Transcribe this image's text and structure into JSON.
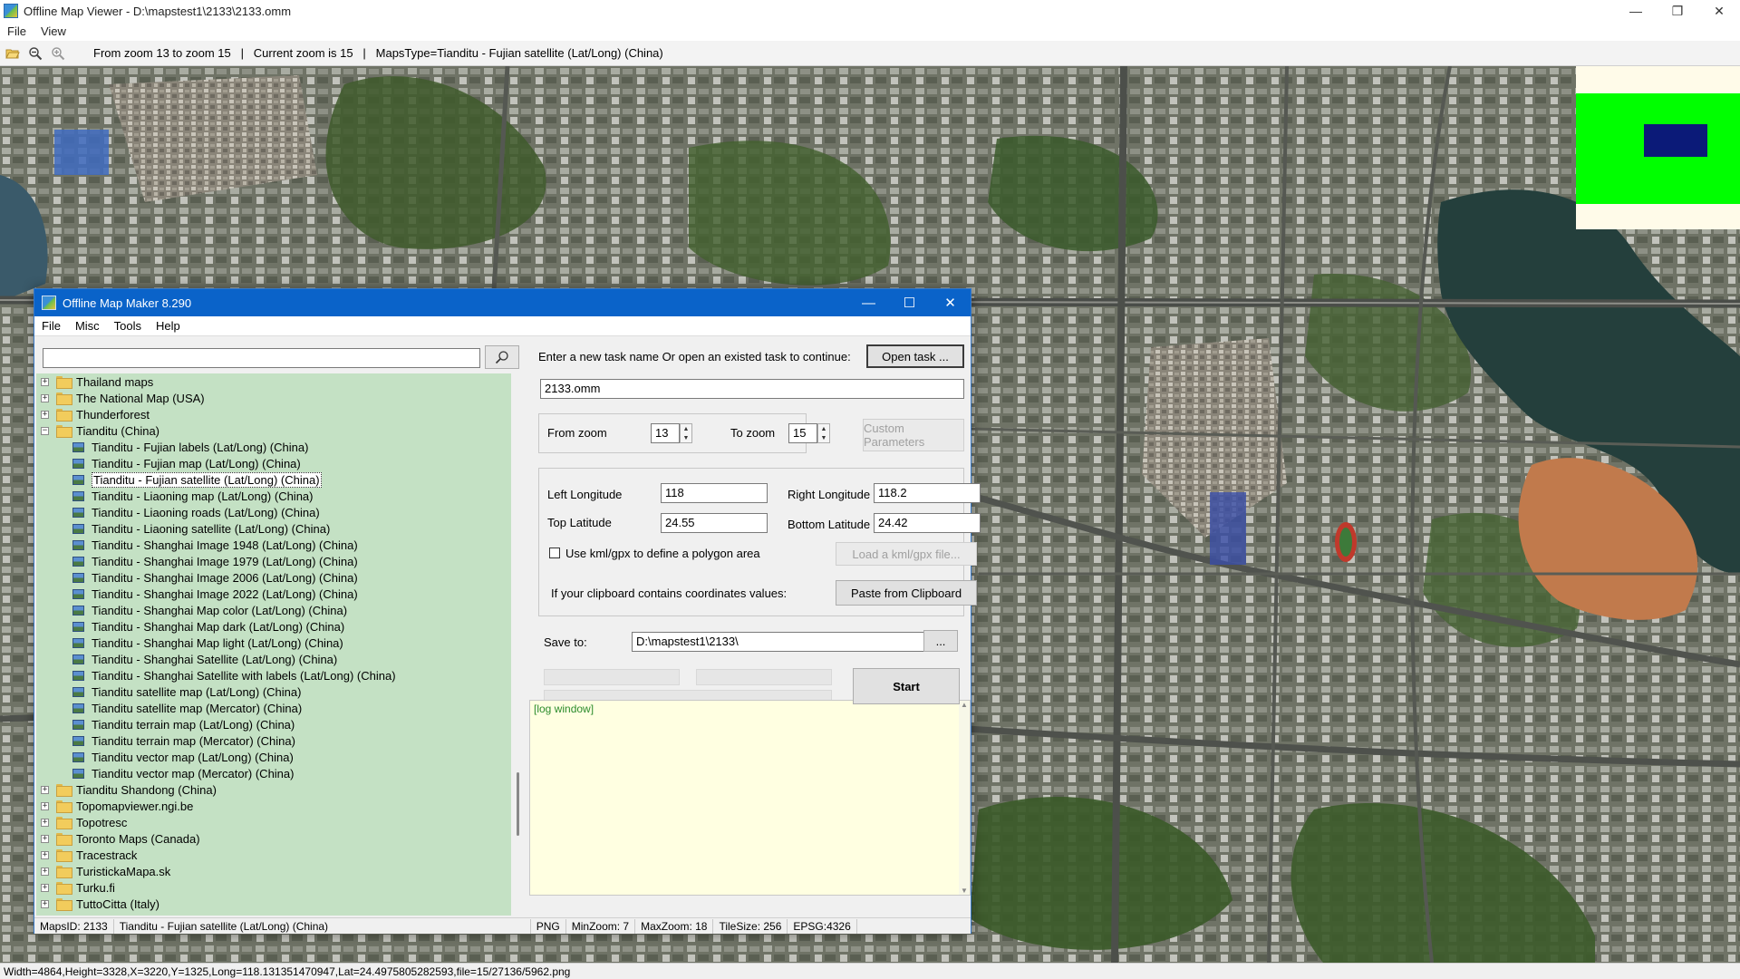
{
  "window": {
    "title": "Offline Map Viewer - D:\\mapstest1\\2133\\2133.omm",
    "controls": [
      "—",
      "❐",
      "✕"
    ]
  },
  "menu": [
    "File",
    "View"
  ],
  "toolbar": {
    "info": "From zoom 13 to zoom 15   |   Current zoom is 15   |   MapsType=Tianditu - Fujian satellite (Lat/Long) (China)"
  },
  "statusbar": {
    "text": "Width=4864,Height=3328,X=3220,Y=1325,Long=118.131351470947,Lat=24.4975805282593,file=15/27136/5962.png"
  },
  "dialog": {
    "title": "Offline Map Maker 8.290",
    "menu": [
      "File",
      "Misc",
      "Tools",
      "Help"
    ],
    "search": {
      "value": "",
      "placeholder": ""
    },
    "tree": [
      {
        "label": "Thailand maps",
        "type": "folder",
        "expanded": false
      },
      {
        "label": "The National Map (USA)",
        "type": "folder",
        "expanded": false
      },
      {
        "label": "Thunderforest",
        "type": "folder",
        "expanded": false
      },
      {
        "label": "Tianditu (China)",
        "type": "folder",
        "expanded": true
      },
      {
        "label": "Tianditu - Fujian labels (Lat/Long) (China)",
        "type": "map"
      },
      {
        "label": "Tianditu - Fujian map (Lat/Long) (China)",
        "type": "map"
      },
      {
        "label": "Tianditu - Fujian satellite (Lat/Long) (China)",
        "type": "map",
        "selected": true
      },
      {
        "label": "Tianditu - Liaoning map (Lat/Long) (China)",
        "type": "map"
      },
      {
        "label": "Tianditu - Liaoning roads (Lat/Long) (China)",
        "type": "map"
      },
      {
        "label": "Tianditu - Liaoning satellite (Lat/Long) (China)",
        "type": "map"
      },
      {
        "label": "Tianditu - Shanghai Image 1948 (Lat/Long) (China)",
        "type": "map"
      },
      {
        "label": "Tianditu - Shanghai Image 1979 (Lat/Long) (China)",
        "type": "map"
      },
      {
        "label": "Tianditu - Shanghai Image 2006 (Lat/Long) (China)",
        "type": "map"
      },
      {
        "label": "Tianditu - Shanghai Image 2022 (Lat/Long) (China)",
        "type": "map"
      },
      {
        "label": "Tianditu - Shanghai Map color (Lat/Long) (China)",
        "type": "map"
      },
      {
        "label": "Tianditu - Shanghai Map dark (Lat/Long) (China)",
        "type": "map"
      },
      {
        "label": "Tianditu - Shanghai Map light (Lat/Long) (China)",
        "type": "map"
      },
      {
        "label": "Tianditu - Shanghai Satellite (Lat/Long) (China)",
        "type": "map"
      },
      {
        "label": "Tianditu - Shanghai Satellite with labels (Lat/Long) (China)",
        "type": "map"
      },
      {
        "label": "Tianditu satellite map (Lat/Long) (China)",
        "type": "map"
      },
      {
        "label": "Tianditu satellite map (Mercator) (China)",
        "type": "map"
      },
      {
        "label": "Tianditu terrain map (Lat/Long) (China)",
        "type": "map"
      },
      {
        "label": "Tianditu terrain map (Mercator) (China)",
        "type": "map"
      },
      {
        "label": "Tianditu vector map (Lat/Long) (China)",
        "type": "map"
      },
      {
        "label": "Tianditu vector map (Mercator) (China)",
        "type": "map"
      },
      {
        "label": "Tianditu Shandong (China)",
        "type": "folder",
        "expanded": false
      },
      {
        "label": "Topomapviewer.ngi.be",
        "type": "folder",
        "expanded": false
      },
      {
        "label": "Topotresc",
        "type": "folder",
        "expanded": false
      },
      {
        "label": "Toronto Maps (Canada)",
        "type": "folder",
        "expanded": false
      },
      {
        "label": "Tracestrack",
        "type": "folder",
        "expanded": false
      },
      {
        "label": "TuristickaMapa.sk",
        "type": "folder",
        "expanded": false
      },
      {
        "label": "Turku.fi",
        "type": "folder",
        "expanded": false
      },
      {
        "label": "TuttoCitta (Italy)",
        "type": "folder",
        "expanded": false
      }
    ],
    "task_prompt": "Enter a new task name Or open an existed task to continue:",
    "open_task_button": "Open task ...",
    "task_name": "2133.omm",
    "from_zoom_label": "From zoom",
    "from_zoom": "13",
    "to_zoom_label": "To zoom",
    "to_zoom": "15",
    "custom_params_button": "Custom Parameters",
    "left_lon_label": "Left Longitude",
    "left_lon": "118",
    "right_lon_label": "Right Longitude",
    "right_lon": "118.2",
    "top_lat_label": "Top Latitude",
    "top_lat": "24.55",
    "bottom_lat_label": "Bottom Latitude",
    "bottom_lat": "24.42",
    "kml_label": "Use kml/gpx to define a polygon area",
    "kml_checked": false,
    "load_kml_button": "Load a kml/gpx file...",
    "clipboard_label": "If your clipboard contains coordinates values:",
    "paste_button": "Paste from Clipboard",
    "save_to_label": "Save to:",
    "save_to": "D:\\mapstest1\\2133\\",
    "browse_button": "...",
    "start_button": "Start",
    "log_text": "[log window]",
    "status": {
      "maps_id": "MapsID: 2133",
      "maps_name": "Tianditu - Fujian satellite (Lat/Long) (China)",
      "format": "PNG",
      "min_zoom": "MinZoom: 7",
      "max_zoom": "MaxZoom: 18",
      "tile_size": "TileSize: 256",
      "epsg": "EPSG:4326"
    }
  },
  "colors": {
    "tree_bg": "#c4e1c4",
    "dialog_title_bg": "#0a63c9",
    "log_bg": "#ffffe1",
    "minimap_area": "#00ff00",
    "minimap_view": "#0b1a78"
  }
}
